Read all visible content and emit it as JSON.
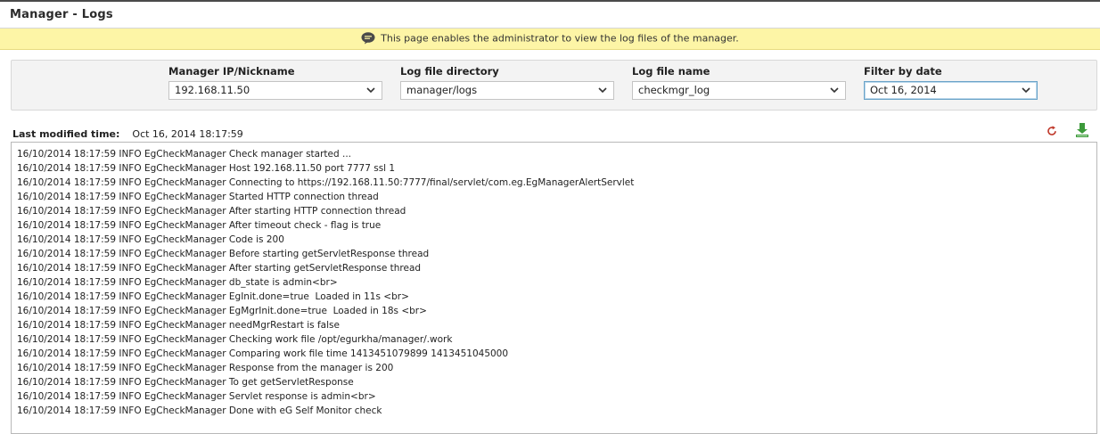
{
  "page": {
    "title": "Manager - Logs"
  },
  "info_bar": {
    "icon": "speech-bubble-icon",
    "text": "This page enables the administrator to view the log files of the manager."
  },
  "filters": {
    "manager": {
      "label": "Manager IP/Nickname",
      "value": "192.168.11.50"
    },
    "directory": {
      "label": "Log file directory",
      "value": "manager/logs"
    },
    "file": {
      "label": "Log file name",
      "value": "checkmgr_log"
    },
    "date": {
      "label": "Filter by date",
      "value": "Oct 16, 2014"
    }
  },
  "last_modified": {
    "label": "Last modified time:",
    "value": "Oct 16, 2014 18:17:59"
  },
  "toolbar": {
    "refresh_icon": "refresh-icon",
    "download_icon": "download-icon"
  },
  "colors": {
    "info_bar_bg": "#fdf5a6",
    "refresh_red": "#c0392b",
    "download_green": "#3c9a3a"
  },
  "log": {
    "lines": [
      "16/10/2014 18:17:59 INFO EgCheckManager Check manager started ...",
      "16/10/2014 18:17:59 INFO EgCheckManager Host 192.168.11.50 port 7777 ssl 1",
      "16/10/2014 18:17:59 INFO EgCheckManager Connecting to https://192.168.11.50:7777/final/servlet/com.eg.EgManagerAlertServlet",
      "16/10/2014 18:17:59 INFO EgCheckManager Started HTTP connection thread",
      "16/10/2014 18:17:59 INFO EgCheckManager After starting HTTP connection thread",
      "16/10/2014 18:17:59 INFO EgCheckManager After timeout check - flag is true",
      "16/10/2014 18:17:59 INFO EgCheckManager Code is 200",
      "16/10/2014 18:17:59 INFO EgCheckManager Before starting getServletResponse thread",
      "16/10/2014 18:17:59 INFO EgCheckManager After starting getServletResponse thread",
      "16/10/2014 18:17:59 INFO EgCheckManager db_state is admin<br>",
      "16/10/2014 18:17:59 INFO EgCheckManager EgInit.done=true  Loaded in 11s <br>",
      "16/10/2014 18:17:59 INFO EgCheckManager EgMgrInit.done=true  Loaded in 18s <br>",
      "16/10/2014 18:17:59 INFO EgCheckManager needMgrRestart is false",
      "16/10/2014 18:17:59 INFO EgCheckManager Checking work file /opt/egurkha/manager/.work",
      "16/10/2014 18:17:59 INFO EgCheckManager Comparing work file time 1413451079899 1413451045000",
      "16/10/2014 18:17:59 INFO EgCheckManager Response from the manager is 200",
      "16/10/2014 18:17:59 INFO EgCheckManager To get getServletResponse",
      "16/10/2014 18:17:59 INFO EgCheckManager Servlet response is admin<br>",
      "16/10/2014 18:17:59 INFO EgCheckManager Done with eG Self Monitor check"
    ]
  }
}
